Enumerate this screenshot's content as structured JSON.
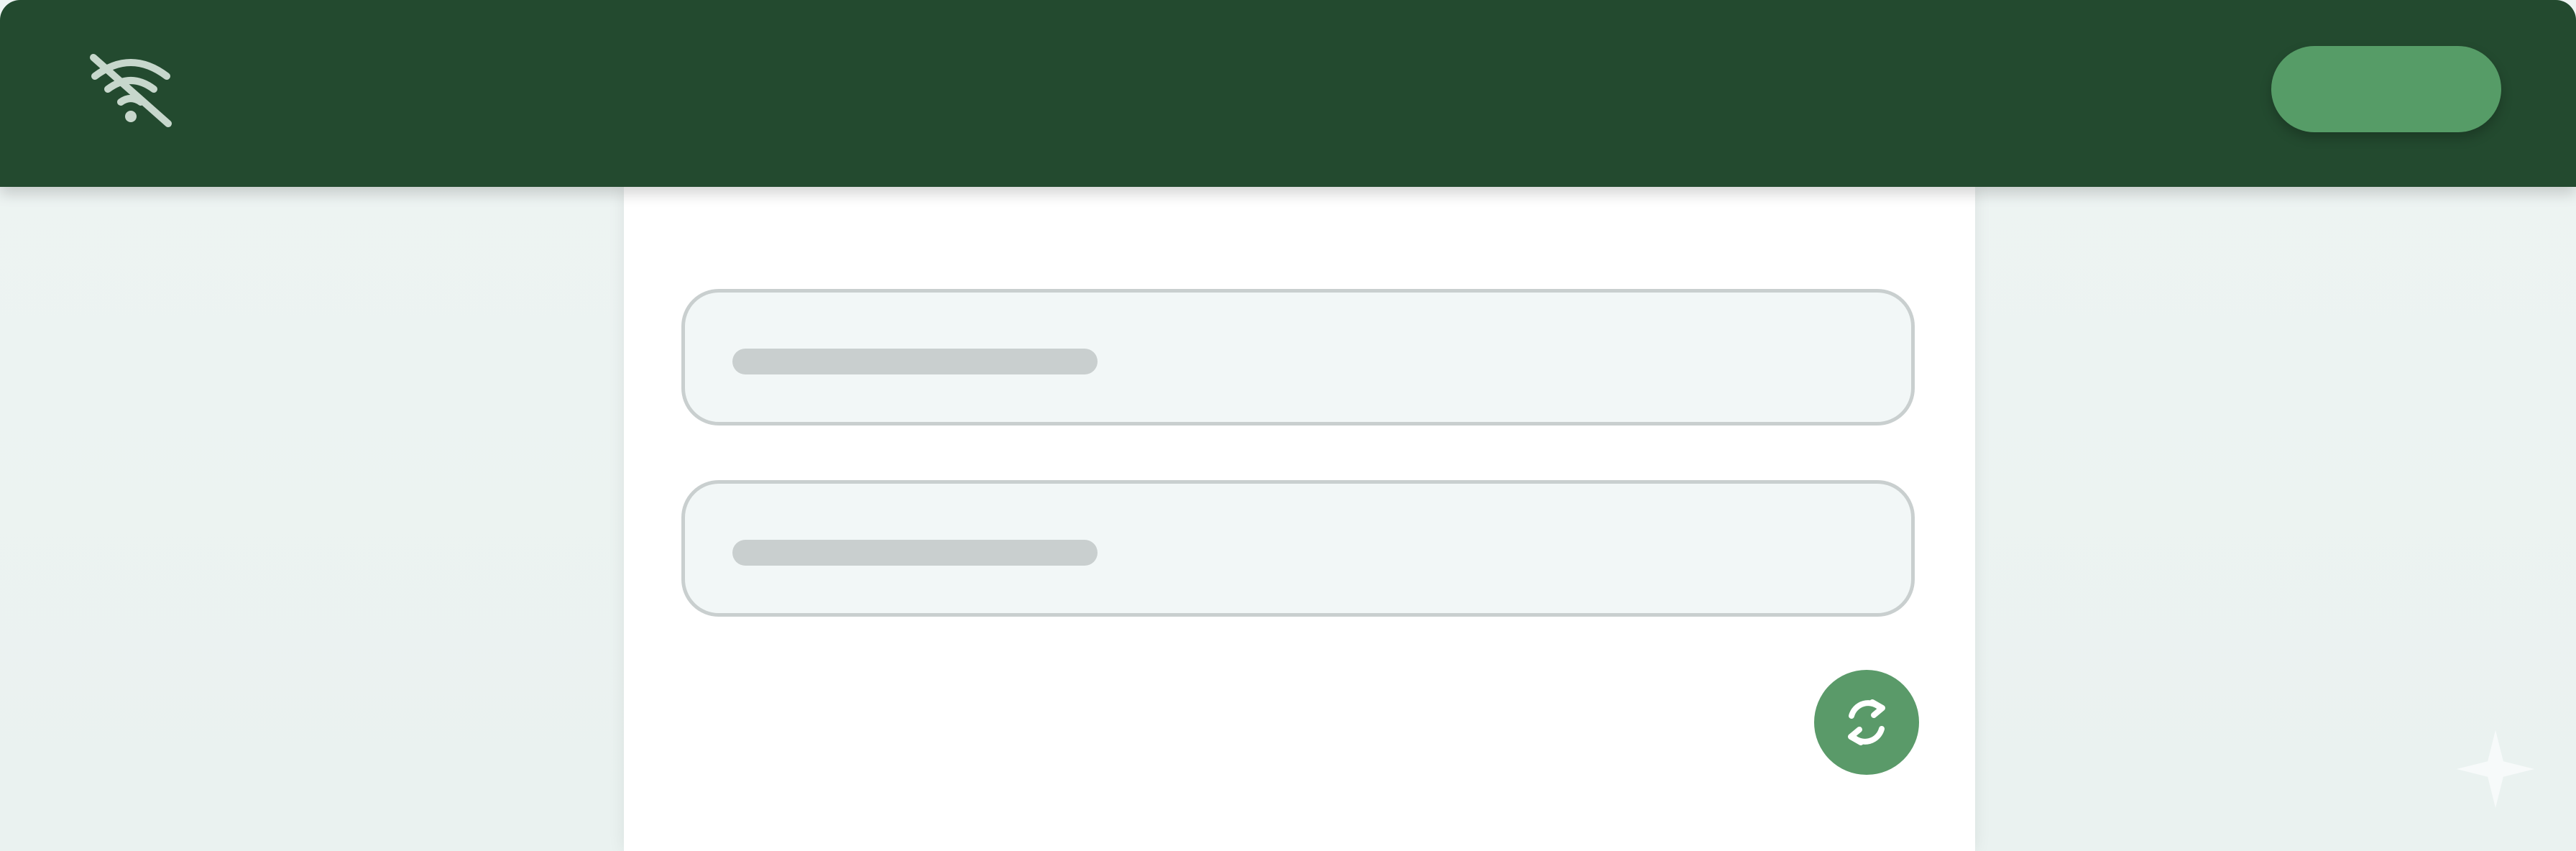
{
  "colors": {
    "header_bg": "#234a2f",
    "accent": "#569c67",
    "page_bg": "#eef4f3",
    "panel_bg": "#ffffff",
    "field_bg": "#f2f7f7",
    "field_border": "#c9cfcf"
  },
  "header": {
    "left_icon": "wifi-off-icon",
    "action_button_label": ""
  },
  "form": {
    "fields": [
      {
        "value": "",
        "placeholder": ""
      },
      {
        "value": "",
        "placeholder": ""
      }
    ],
    "refresh_icon": "refresh-icon"
  },
  "decor": {
    "corner_icon": "sparkle-icon"
  }
}
